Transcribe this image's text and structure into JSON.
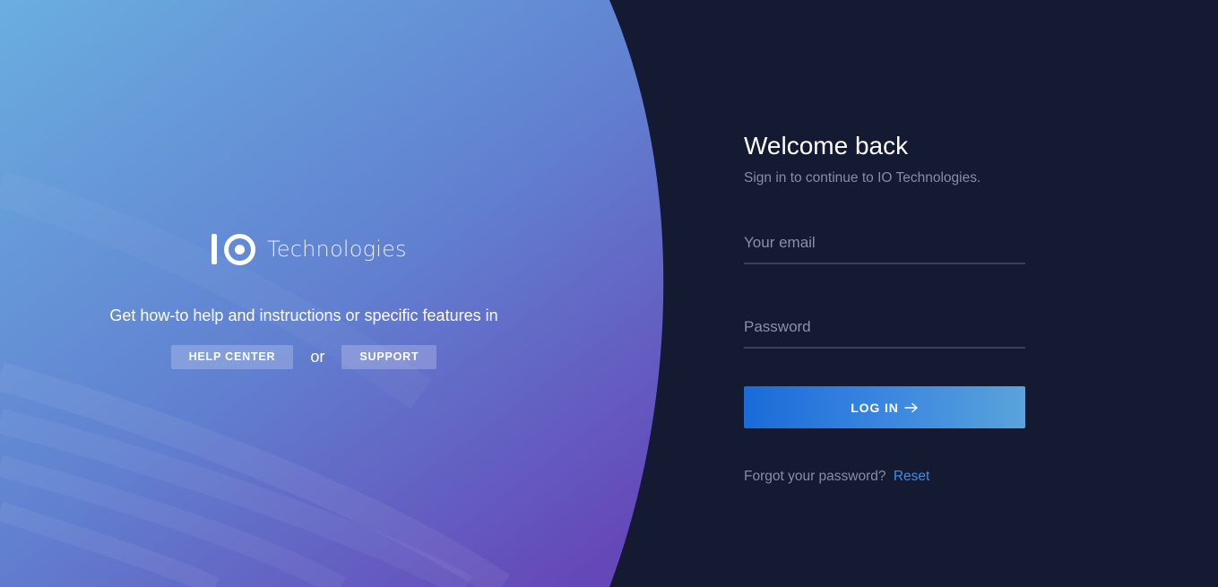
{
  "brand": {
    "wordmark": "Technologies"
  },
  "hero": {
    "help_text": "Get how-to help and instructions or specific features in",
    "help_center_label": "HELP CENTER",
    "or_label": "or",
    "support_label": "SUPPORT"
  },
  "login": {
    "title": "Welcome back",
    "subtitle": "Sign in to continue to IO Technologies.",
    "email_placeholder": "Your email",
    "email_value": "",
    "password_placeholder": "Password",
    "password_value": "",
    "login_label": "LOG IN",
    "forgot_text": "Forgot your password?",
    "reset_label": "Reset"
  },
  "icons": {
    "logo": "io-logo-icon",
    "login_arrow": "arrow-right-icon"
  },
  "colors": {
    "background": "#131a31",
    "hero_gradient_start": "#6aaee0",
    "hero_gradient_end": "#6548b8",
    "button_gradient_start": "#1a6bd8",
    "button_gradient_end": "#5aa3db",
    "link": "#3d8ee6"
  }
}
